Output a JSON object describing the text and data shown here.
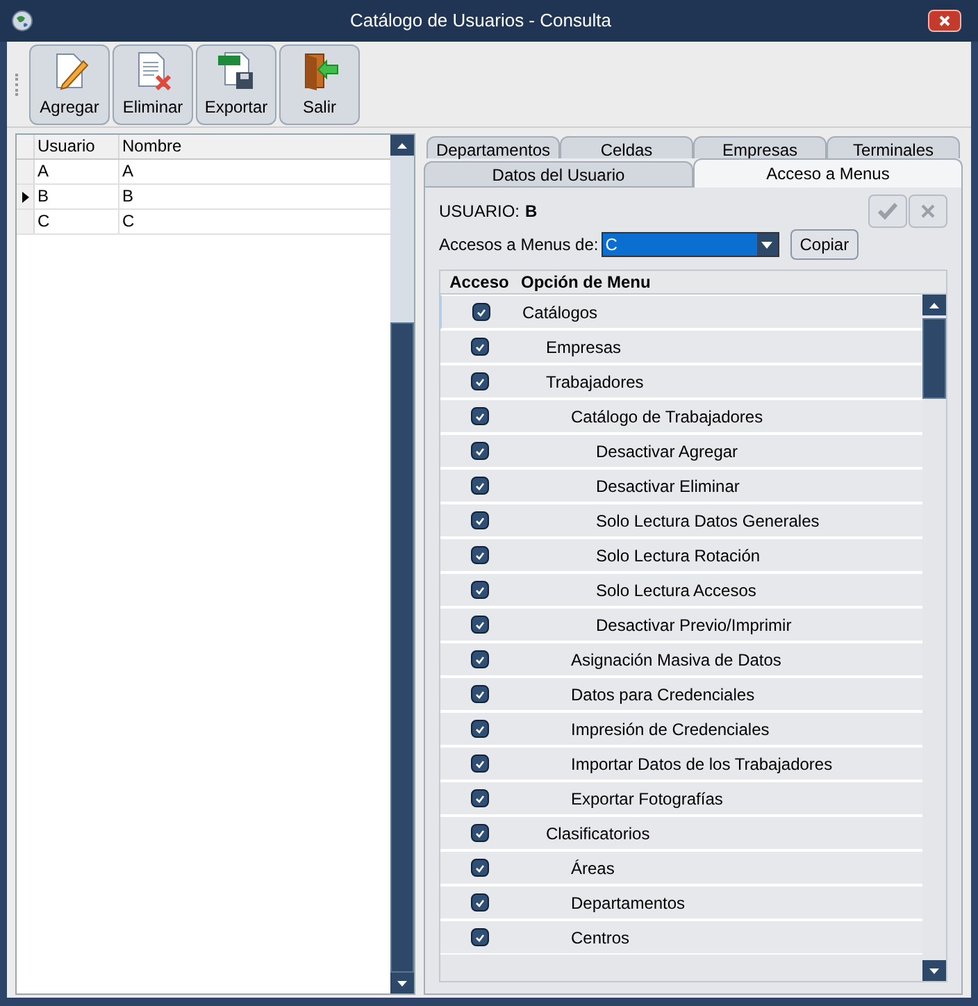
{
  "window": {
    "title": "Catálogo de Usuarios - Consulta"
  },
  "toolbar": [
    {
      "label": "Agregar",
      "kind": "add"
    },
    {
      "label": "Eliminar",
      "kind": "delete"
    },
    {
      "label": "Exportar",
      "kind": "export"
    },
    {
      "label": "Salir",
      "kind": "exit"
    }
  ],
  "users_table": {
    "columns": [
      "Usuario",
      "Nombre"
    ],
    "rows": [
      {
        "cells": [
          "A",
          "A"
        ],
        "selected": false
      },
      {
        "cells": [
          "B",
          "B"
        ],
        "selected": true
      },
      {
        "cells": [
          "C",
          "C"
        ],
        "selected": false
      }
    ]
  },
  "tabs_row_back": [
    {
      "label": "Departamentos",
      "selected": false
    },
    {
      "label": "Celdas",
      "selected": false
    },
    {
      "label": "Empresas",
      "selected": false
    },
    {
      "label": "Terminales",
      "selected": false
    }
  ],
  "tabs_row_front": [
    {
      "label": "Datos del Usuario",
      "selected": false
    },
    {
      "label": "Acceso a Menus",
      "selected": true
    }
  ],
  "user_label": "USUARIO:",
  "user_value": "B",
  "copy_from": {
    "label": "Accesos a Menus de:",
    "value": "C",
    "button": "Copiar"
  },
  "menu_table": {
    "columns": [
      "Acceso",
      "Opción de Menu"
    ],
    "items": [
      {
        "label": "Catálogos",
        "checked": true,
        "children": [
          {
            "label": "Empresas",
            "checked": true
          },
          {
            "label": "Trabajadores",
            "checked": true,
            "children": [
              {
                "label": "Catálogo de Trabajadores",
                "checked": true,
                "children": [
                  {
                    "label": "Desactivar Agregar",
                    "checked": true
                  },
                  {
                    "label": "Desactivar Eliminar",
                    "checked": true
                  },
                  {
                    "label": "Solo Lectura Datos Generales",
                    "checked": true
                  },
                  {
                    "label": "Solo Lectura Rotación",
                    "checked": true
                  },
                  {
                    "label": "Solo Lectura Accesos",
                    "checked": true
                  },
                  {
                    "label": "Desactivar Previo/Imprimir",
                    "checked": true
                  }
                ]
              },
              {
                "label": "Asignación Masiva de Datos",
                "checked": true
              },
              {
                "label": "Datos para Credenciales",
                "checked": true
              },
              {
                "label": "Impresión de Credenciales",
                "checked": true
              },
              {
                "label": "Importar Datos de los Trabajadores",
                "checked": true
              },
              {
                "label": "Exportar Fotografías",
                "checked": true
              }
            ]
          },
          {
            "label": "Clasificatorios",
            "checked": true,
            "children": [
              {
                "label": "Áreas",
                "checked": true
              },
              {
                "label": "Departamentos",
                "checked": true
              },
              {
                "label": "Centros",
                "checked": true
              }
            ]
          }
        ]
      }
    ]
  }
}
